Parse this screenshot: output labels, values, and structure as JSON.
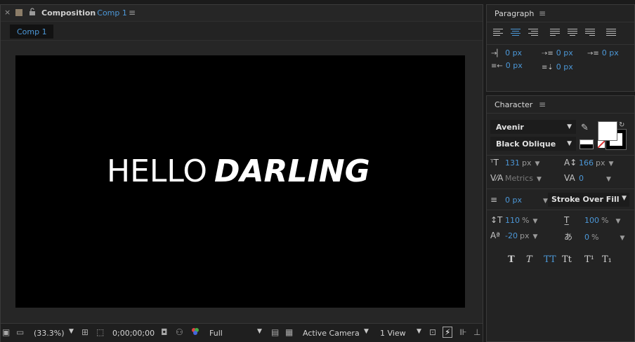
{
  "composition": {
    "close_glyph": "×",
    "lock_glyph": "🔓",
    "title_prefix": "Composition",
    "title_comp": "Comp 1",
    "menu_glyph": "≡",
    "tab_label": "Comp 1",
    "canvas_text_light": "HELLO",
    "canvas_text_bold": "DARLING",
    "footer": {
      "zoom": "(33.3%)",
      "timecode": "0;00;00;00",
      "resolution": "Full",
      "camera": "Active Camera",
      "views": "1 View"
    }
  },
  "paragraph": {
    "title": "Paragraph",
    "menu_glyph": "≡",
    "indent_left": "0 px",
    "space_before": "0 px",
    "indent_first": "0 px",
    "indent_right": "0 px",
    "space_after": "0 px"
  },
  "character": {
    "title": "Character",
    "menu_glyph": "≡",
    "font_family": "Avenir",
    "font_style": "Black Oblique",
    "font_size": "131",
    "font_size_unit": "px",
    "leading": "166",
    "leading_unit": "px",
    "kerning": "Metrics",
    "tracking": "0",
    "stroke_width": "0 px",
    "stroke_mode": "Stroke Over Fill",
    "vertical_scale": "110",
    "vertical_scale_unit": "%",
    "horizontal_scale": "100",
    "horizontal_scale_unit": "%",
    "baseline_shift": "-20",
    "baseline_shift_unit": "px",
    "tsume": "0",
    "tsume_unit": "%",
    "fill_color": "#ffffff",
    "stroke_color": "#000000",
    "accent_color": "#4c98d8",
    "style_buttons": [
      "T",
      "T",
      "TT",
      "Tt",
      "T¹",
      "T₁"
    ]
  }
}
